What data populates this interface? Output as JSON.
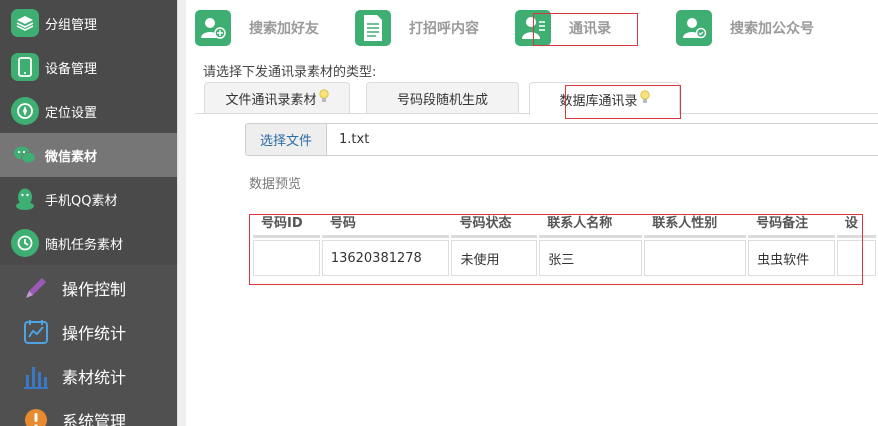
{
  "sidebar": {
    "items": [
      {
        "label": "分组管理",
        "icon": "layers-icon"
      },
      {
        "label": "设备管理",
        "icon": "phone-icon"
      },
      {
        "label": "定位设置",
        "icon": "compass-icon"
      },
      {
        "label": "微信素材",
        "icon": "wechat-icon"
      },
      {
        "label": "手机QQ素材",
        "icon": "qq-icon"
      },
      {
        "label": "随机任务素材",
        "icon": "random-icon"
      }
    ],
    "active_index": 3,
    "lower_items": [
      {
        "label": "操作控制",
        "icon": "pencil-icon"
      },
      {
        "label": "操作统计",
        "icon": "chart-calendar-icon"
      },
      {
        "label": "素材统计",
        "icon": "bar-chart-icon"
      },
      {
        "label": "系统管理",
        "icon": "settings-icon"
      }
    ]
  },
  "toolbar": {
    "items": [
      {
        "label": "搜索加好友",
        "icon": "add-friend-icon"
      },
      {
        "label": "打招呼内容",
        "icon": "document-icon"
      },
      {
        "label": "通讯录",
        "icon": "contacts-icon"
      },
      {
        "label": "搜索加公众号",
        "icon": "official-account-icon"
      }
    ]
  },
  "prompt": "请选择下发通讯录素材的类型:",
  "tabs": [
    {
      "label": "文件通讯录素材"
    },
    {
      "label": "号码段随机生成"
    },
    {
      "label": "数据库通讯录"
    }
  ],
  "active_tab": 2,
  "file": {
    "button_label": "选择文件",
    "value": "1.txt"
  },
  "preview_label": "数据预览",
  "table": {
    "columns": [
      "号码ID",
      "号码",
      "号码状态",
      "联系人名称",
      "联系人性别",
      "号码备注",
      "设"
    ],
    "rows": [
      [
        "",
        "13620381278",
        "未使用",
        "张三",
        "",
        "虫虫软件",
        ""
      ]
    ]
  },
  "colors": {
    "sidebar_bg": "#4a4a4a",
    "sidebar_active": "#767676",
    "icon_green": "#3fae72",
    "highlight_red": "#d9363e"
  }
}
